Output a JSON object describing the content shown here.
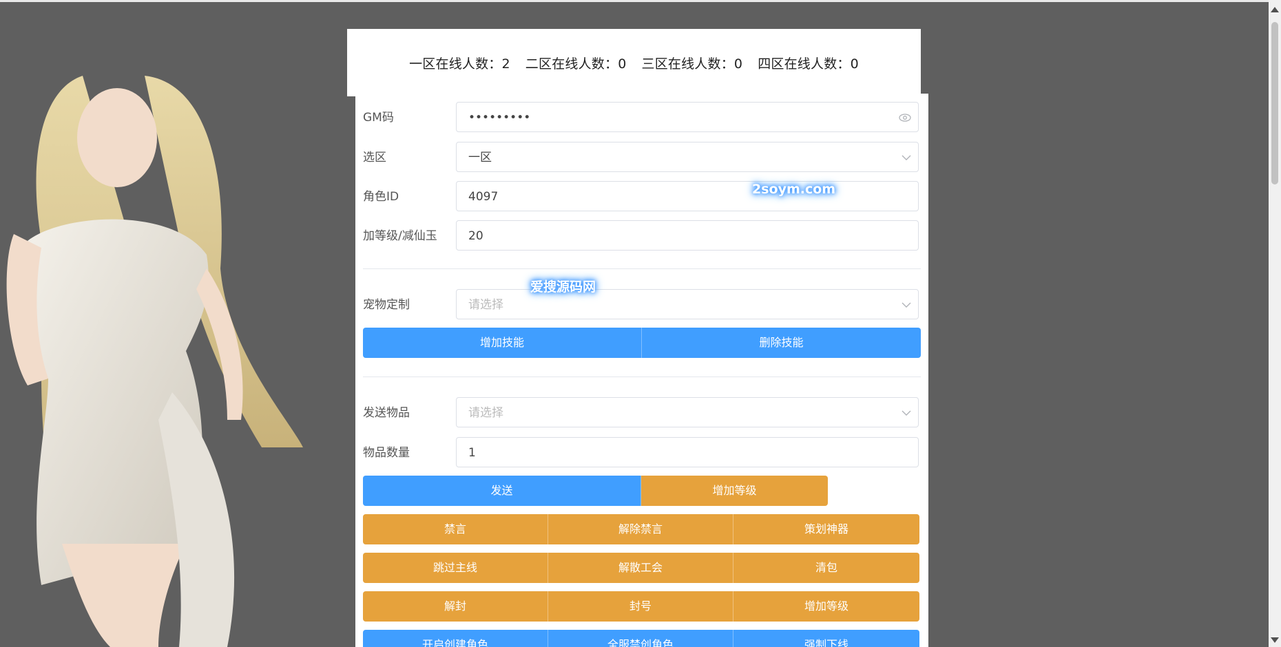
{
  "header": {
    "zones": [
      {
        "text": "一区在线人数：2"
      },
      {
        "text": "二区在线人数：0"
      },
      {
        "text": "三区在线人数：0"
      },
      {
        "text": "四区在线人数：0"
      }
    ]
  },
  "form": {
    "gm": {
      "label": "GM码",
      "value": "•••••••••"
    },
    "zone": {
      "label": "选区",
      "value": "一区"
    },
    "role_id": {
      "label": "角色ID",
      "value": "4097"
    },
    "level": {
      "label": "加等级/减仙玉",
      "value": "20"
    },
    "pet": {
      "label": "宠物定制",
      "placeholder": "请选择"
    },
    "item": {
      "label": "发送物品",
      "placeholder": "请选择"
    },
    "quantity": {
      "label": "物品数量",
      "value": "1"
    }
  },
  "buttons": {
    "add_skill": "增加技能",
    "remove_skill": "删除技能",
    "send": "发送",
    "add_level_1": "增加等级",
    "mute": "禁言",
    "unmute": "解除禁言",
    "planner_artifact": "策划神器",
    "skip_main": "跳过主线",
    "disband_guild": "解散工会",
    "clear_bag": "清包",
    "unban": "解封",
    "ban": "封号",
    "add_level_2": "增加等级",
    "enable_create_role": "开启创建角色",
    "server_ban_create": "全服禁创角色",
    "force_offline": "强制下线"
  },
  "watermarks": {
    "domain": "2soym.com",
    "site": "爱搜源码网"
  },
  "colors": {
    "primary": "#409eff",
    "warning": "#e6a23c",
    "background": "#5f5f5f"
  }
}
